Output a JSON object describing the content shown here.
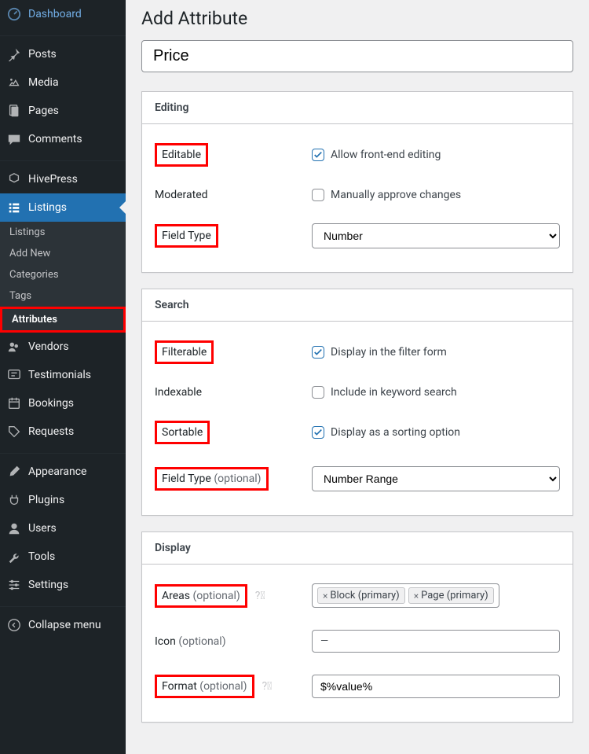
{
  "sidebar": {
    "items": [
      {
        "label": "Dashboard"
      },
      {
        "label": "Posts"
      },
      {
        "label": "Media"
      },
      {
        "label": "Pages"
      },
      {
        "label": "Comments"
      },
      {
        "label": "HivePress"
      },
      {
        "label": "Listings"
      },
      {
        "label": "Vendors"
      },
      {
        "label": "Testimonials"
      },
      {
        "label": "Bookings"
      },
      {
        "label": "Requests"
      },
      {
        "label": "Appearance"
      },
      {
        "label": "Plugins"
      },
      {
        "label": "Users"
      },
      {
        "label": "Tools"
      },
      {
        "label": "Settings"
      },
      {
        "label": "Collapse menu"
      }
    ],
    "submenu": [
      {
        "label": "Listings"
      },
      {
        "label": "Add New"
      },
      {
        "label": "Categories"
      },
      {
        "label": "Tags"
      },
      {
        "label": "Attributes"
      }
    ]
  },
  "page": {
    "title": "Add Attribute",
    "name_value": "Price"
  },
  "editing": {
    "heading": "Editing",
    "editable_label": "Editable",
    "editable_check": "Allow front-end editing",
    "moderated_label": "Moderated",
    "moderated_check": "Manually approve changes",
    "fieldtype_label": "Field Type",
    "fieldtype_value": "Number"
  },
  "search": {
    "heading": "Search",
    "filterable_label": "Filterable",
    "filterable_check": "Display in the filter form",
    "indexable_label": "Indexable",
    "indexable_check": "Include in keyword search",
    "sortable_label": "Sortable",
    "sortable_check": "Display as a sorting option",
    "fieldtype_label_main": "Field Type",
    "fieldtype_label_opt": "(optional)",
    "fieldtype_value": "Number Range"
  },
  "display": {
    "heading": "Display",
    "areas_label_main": "Areas",
    "areas_label_opt": "(optional)",
    "areas_tags": [
      "Block (primary)",
      "Page (primary)"
    ],
    "icon_label_main": "Icon",
    "icon_label_opt": "(optional)",
    "icon_value": "—",
    "format_label_main": "Format",
    "format_label_opt": "(optional)",
    "format_value": "$%value%"
  }
}
